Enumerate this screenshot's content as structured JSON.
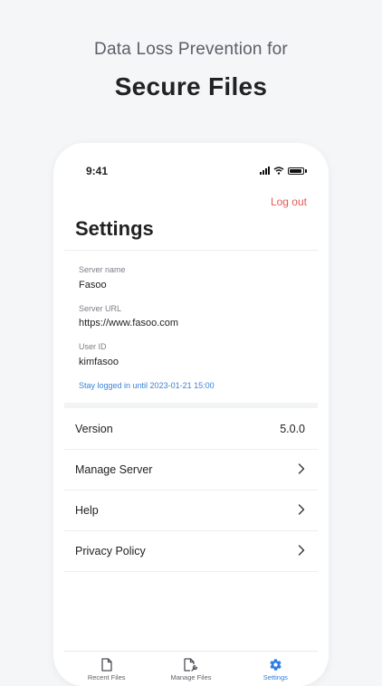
{
  "headline": {
    "subtitle": "Data Loss Prevention for",
    "title": "Secure Files"
  },
  "status_bar": {
    "time": "9:41"
  },
  "header": {
    "logout_label": "Log out",
    "page_title": "Settings"
  },
  "account": {
    "server_name_label": "Server name",
    "server_name": "Fasoo",
    "server_url_label": "Server URL",
    "server_url": "https://www.fasoo.com",
    "user_id_label": "User ID",
    "user_id": "kimfasoo",
    "stay_logged_in": "Stay logged in until 2023-01-21 15:00"
  },
  "menu": {
    "version_label": "Version",
    "version_value": "5.0.0",
    "manage_server": "Manage Server",
    "help": "Help",
    "privacy_policy": "Privacy Policy"
  },
  "tabs": {
    "recent_files": "Recent Files",
    "manage_files": "Manage Files",
    "settings": "Settings"
  },
  "colors": {
    "accent": "#2e7de1",
    "logout": "#e25b54",
    "background": "#f5f6f8"
  },
  "icons": {
    "recent_files": "document-icon",
    "manage_files": "document-wrench-icon",
    "settings": "gear-icon",
    "row_chevron": "chevron-right-icon"
  }
}
